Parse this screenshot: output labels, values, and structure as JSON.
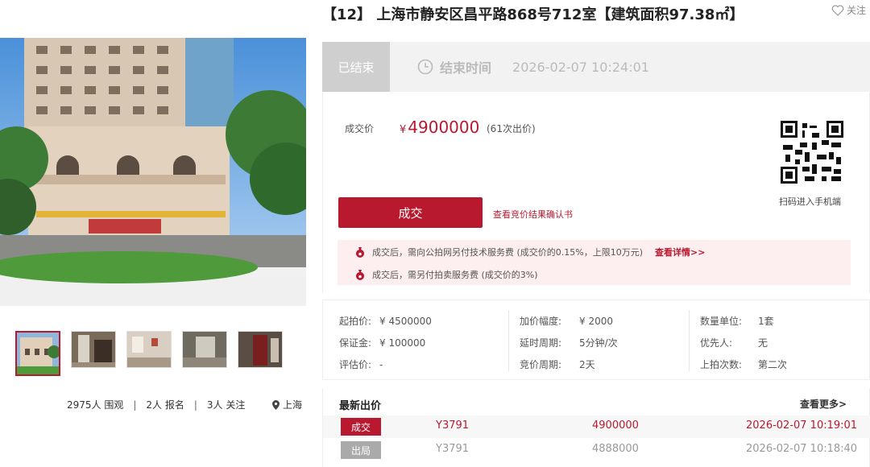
{
  "listing": {
    "title": "【12】 上海市静安区昌平路868号712室【建筑面积97.38㎡】",
    "follow_label": "关注"
  },
  "status": {
    "chip": "已结束",
    "end_label": "结束时间",
    "end_time": "2026-02-07 10:24:01"
  },
  "deal": {
    "price_label": "成交价",
    "currency": "¥",
    "price": "4900000",
    "bid_count": "(61次出价)",
    "button_label": "成交",
    "confirm_link": "查看竞价结果确认书",
    "qr_label": "扫码进入手机端"
  },
  "notices": [
    {
      "text": "成交后，需向公拍网另付技术服务费 (成交价的0.15%，上限10万元)",
      "link": "查看详情>>"
    },
    {
      "text": "成交后，需另付拍卖服务费 (成交价的3%)",
      "link": ""
    }
  ],
  "properties": {
    "col1": [
      {
        "key": "起拍价:",
        "value": "¥ 4500000"
      },
      {
        "key": "保证金:",
        "value": "¥ 100000"
      },
      {
        "key": "评估价:",
        "value": "-"
      }
    ],
    "col2": [
      {
        "key": "加价幅度:",
        "value": "¥ 2000"
      },
      {
        "key": "延时周期:",
        "value": "5分钟/次"
      },
      {
        "key": "竞价周期:",
        "value": "2天"
      }
    ],
    "col3": [
      {
        "key": "数量单位:",
        "value": "1套"
      },
      {
        "key": "优先人:",
        "value": "无"
      },
      {
        "key": "上拍次数:",
        "value": "第二次"
      }
    ]
  },
  "stats": {
    "views": "2975人 围观",
    "signups": "2人 报名",
    "follows": "3人 关注",
    "location": "上海"
  },
  "latest_bids": {
    "title": "最新出价",
    "more_link": "查看更多>",
    "rows": [
      {
        "tag": "成交",
        "user": "Y3791",
        "price": "4900000",
        "time": "2026-02-07 10:19:01"
      },
      {
        "tag": "出局",
        "user": "Y3791",
        "price": "4888000",
        "time": "2026-02-07 10:18:40"
      }
    ]
  },
  "colors": {
    "accent": "#b8192f",
    "chip_gray": "#cfcfcf",
    "notice_bg": "#fdeef0"
  }
}
